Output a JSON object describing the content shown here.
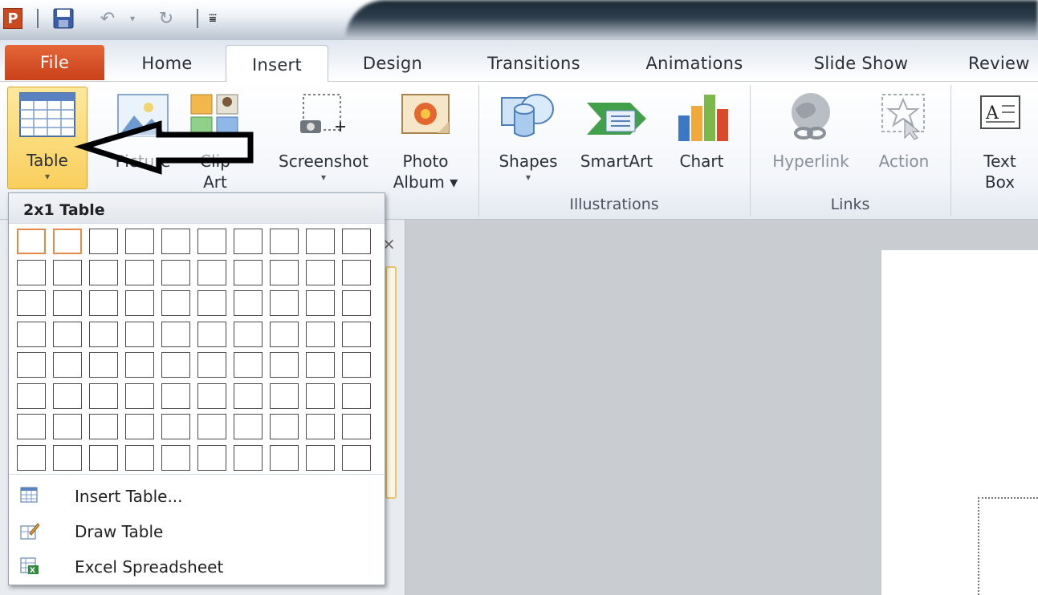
{
  "qat": {
    "app_icon": "P",
    "icons": [
      "save-icon",
      "undo-icon",
      "undo-dropdown-icon",
      "redo-icon",
      "customize-qat-icon"
    ]
  },
  "tabs": {
    "file": "File",
    "home": "Home",
    "insert": "Insert",
    "design": "Design",
    "transitions": "Transitions",
    "animations": "Animations",
    "slide_show": "Slide Show",
    "review": "Review"
  },
  "ribbon": {
    "table": "Table",
    "picture": "Picture",
    "clip_art_1": "Clip",
    "clip_art_2": "Art",
    "screenshot": "Screenshot",
    "photo_album_1": "Photo",
    "photo_album_2": "Album ▾",
    "shapes": "Shapes",
    "smartart": "SmartArt",
    "chart": "Chart",
    "hyperlink": "Hyperlink",
    "action": "Action",
    "text_box_1": "Text",
    "text_box_2": "Box",
    "group_illustrations": "Illustrations",
    "group_links": "Links",
    "dropdown_glyph": "▾"
  },
  "dropdown": {
    "header": "2x1 Table",
    "grid_columns": 10,
    "grid_rows": 8,
    "selected_columns": 2,
    "selected_rows": 1,
    "items": {
      "insert_table": "Insert Table...",
      "draw_table": "Draw Table",
      "excel_spreadsheet": "Excel Spreadsheet"
    }
  },
  "panel": {
    "close_glyph": "×"
  },
  "colors": {
    "file_tab": "#d2501f",
    "table_button_active": "#f9cf5d",
    "grid_selected": "#e48a4a"
  }
}
